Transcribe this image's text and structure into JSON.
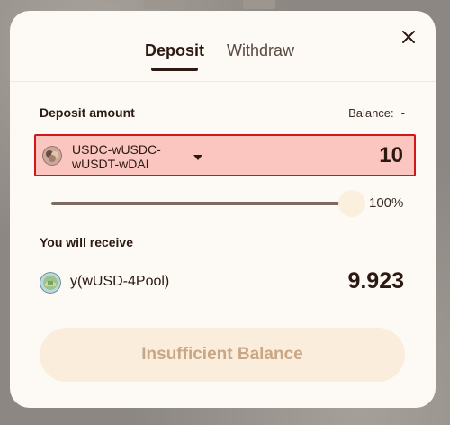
{
  "tabs": [
    {
      "label": "Deposit",
      "active": true
    },
    {
      "label": "Withdraw",
      "active": false
    }
  ],
  "deposit": {
    "section_label": "Deposit amount",
    "balance_label": "Balance:",
    "balance_value": "-",
    "token": {
      "name": "USDC-wUSDC-wUSDT-wDAI",
      "name_line1": "USDC-wUSDC-",
      "name_line2": "wUSDT-wDAI",
      "icon": "stablecoin-pool-icon"
    },
    "amount": "10",
    "slider_percent": "100%",
    "slider_value": 1.0
  },
  "receive": {
    "section_label": "You will receive",
    "token_name": "y(wUSD-4Pool)",
    "token_icon": "yield-pool-icon",
    "amount": "9.923"
  },
  "submit": {
    "label": "Insufficient Balance",
    "disabled": true
  },
  "colors": {
    "text": "#2c1a12",
    "highlight_fill": "#fbc5c0",
    "highlight_border": "#d01818",
    "button_bg": "#fbeddb",
    "button_text": "#c9a684"
  }
}
